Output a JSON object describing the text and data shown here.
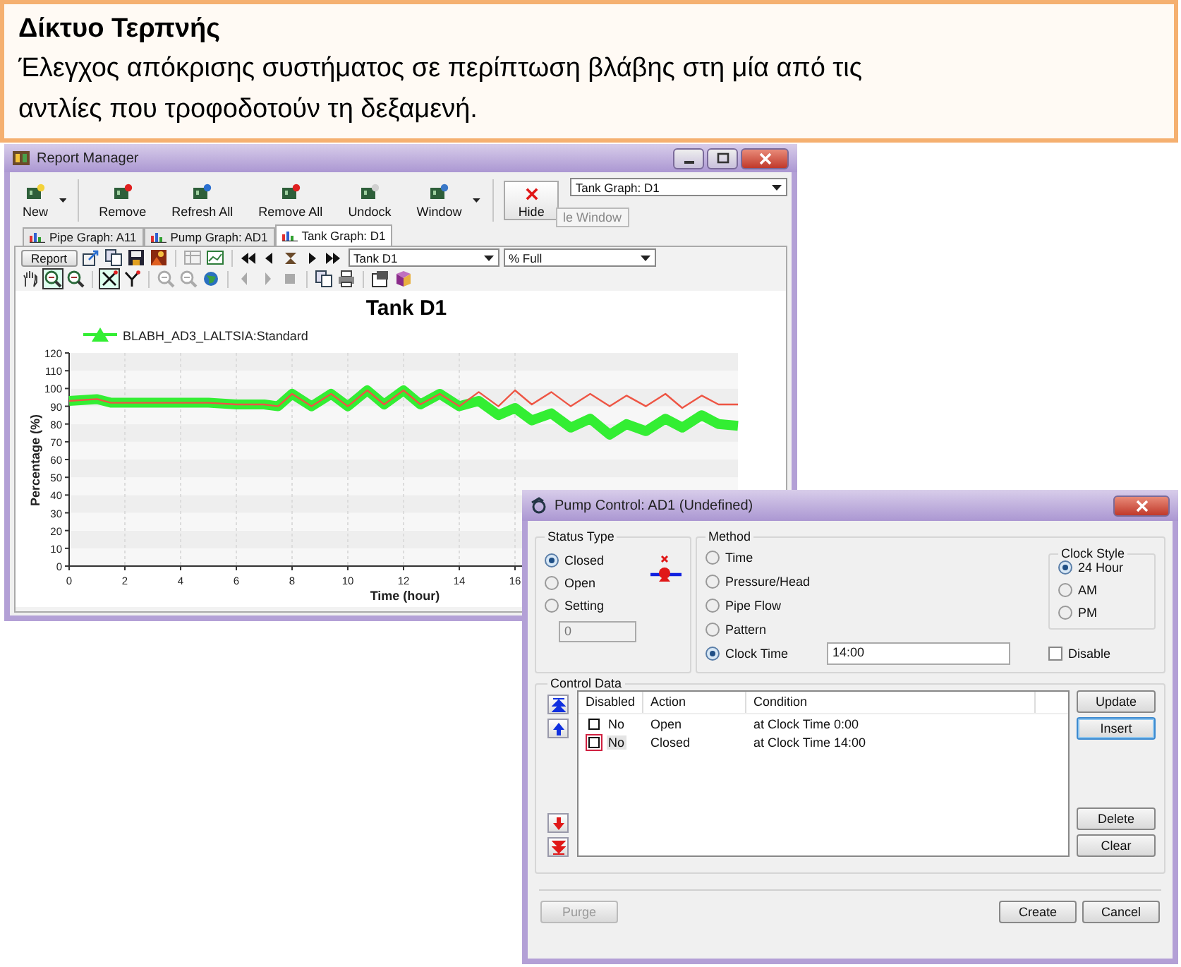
{
  "header": {
    "title": "Δίκτυο Τερπνής",
    "text": "Έλεγχος απόκρισης συστήματος σε περίπτωση βλάβης στη μία από τις αντλίες που τροφοδοτούν τη δεξαμενή."
  },
  "report_manager": {
    "title": "Report Manager",
    "toolbar": [
      {
        "label": "New",
        "kind": "new",
        "dropdown": true
      },
      {
        "label": "Remove",
        "kind": "remove",
        "dropdown": false
      },
      {
        "label": "Refresh All",
        "kind": "refresh",
        "dropdown": false
      },
      {
        "label": "Remove All",
        "kind": "remove",
        "dropdown": false
      },
      {
        "label": "Undock",
        "kind": "undock",
        "dropdown": false
      },
      {
        "label": "Window",
        "kind": "window",
        "dropdown": true
      }
    ],
    "hide_button": {
      "label": "Hide",
      "tooltip": "le Window"
    },
    "graph_select": "Tank Graph: D1",
    "tabs": [
      {
        "label": "Pipe Graph: A11",
        "selected": false
      },
      {
        "label": "Pump Graph: AD1",
        "selected": false
      },
      {
        "label": "Tank Graph: D1",
        "selected": true
      }
    ],
    "report_button": "Report",
    "object_select": "Tank D1",
    "variable_select": "% Full",
    "chart_data": {
      "type": "line",
      "title": "Tank D1",
      "xlabel": "Time (hour)",
      "ylabel": "Percentage (%)",
      "x": [
        0,
        1,
        1.5,
        3,
        4,
        5,
        6,
        7,
        7.5,
        8,
        8.7,
        9.4,
        10,
        10.7,
        11.3,
        12,
        12.6,
        13.3,
        14,
        14.7,
        15.4,
        16,
        16.6,
        17.3,
        18,
        18.7,
        19.4,
        20,
        20.7,
        21.4,
        22,
        22.7,
        23.3,
        24
      ],
      "series": [
        {
          "name": "BLABH_AD3_LALTSIA:Standard",
          "color": "#33ee33",
          "values": [
            93,
            94,
            92,
            92,
            92,
            92,
            91,
            91,
            90,
            97,
            90,
            97,
            90,
            99,
            91,
            99,
            91,
            97,
            90,
            93,
            85,
            89,
            82,
            86,
            78,
            83,
            74,
            80,
            76,
            83,
            78,
            85,
            80,
            79
          ]
        },
        {
          "color": "#ee5544",
          "values": [
            93,
            94,
            92,
            92,
            92,
            92,
            91,
            91,
            90,
            97,
            90,
            97,
            90,
            99,
            91,
            99,
            91,
            97,
            90,
            98,
            90,
            99,
            91,
            98,
            90,
            97,
            90,
            96,
            90,
            97,
            89,
            96,
            91,
            91
          ]
        }
      ],
      "xlim": [
        0,
        24
      ],
      "ylim": [
        0,
        120
      ],
      "grid": true,
      "xticks": [
        0,
        2,
        4,
        6,
        8,
        10,
        12,
        14,
        16
      ],
      "yticks": [
        0,
        10,
        20,
        30,
        40,
        50,
        60,
        70,
        80,
        90,
        100,
        110,
        120
      ]
    }
  },
  "pump_control": {
    "title": "Pump Control: AD1 (Undefined)",
    "status_type": {
      "label": "Status Type",
      "options": [
        {
          "label": "Closed",
          "selected": true
        },
        {
          "label": "Open",
          "selected": false
        },
        {
          "label": "Setting",
          "selected": false
        }
      ],
      "setting_value": "0"
    },
    "method": {
      "label": "Method",
      "options": [
        {
          "label": "Time",
          "selected": false
        },
        {
          "label": "Pressure/Head",
          "selected": false
        },
        {
          "label": "Pipe Flow",
          "selected": false
        },
        {
          "label": "Pattern",
          "selected": false
        },
        {
          "label": "Clock Time",
          "selected": true
        }
      ],
      "clock_time": "14:00"
    },
    "clock_style": {
      "label": "Clock Style",
      "options": [
        {
          "label": "24 Hour",
          "selected": true
        },
        {
          "label": "AM",
          "selected": false
        },
        {
          "label": "PM",
          "selected": false
        }
      ]
    },
    "disable": {
      "label": "Disable",
      "checked": false
    },
    "control_data": {
      "label": "Control Data",
      "columns": [
        "Disabled",
        "Action",
        "Condition"
      ],
      "rows": [
        {
          "disabled": "No",
          "checked": false,
          "focused": false,
          "action": "Open",
          "condition": "at Clock Time 0:00"
        },
        {
          "disabled": "No",
          "checked": false,
          "focused": true,
          "action": "Closed",
          "condition": "at Clock Time 14:00"
        }
      ],
      "side_buttons": [
        {
          "label": "Update",
          "default": false
        },
        {
          "label": "Insert",
          "default": true
        }
      ],
      "lower_buttons": [
        {
          "label": "Delete",
          "default": false
        },
        {
          "label": "Clear",
          "default": false
        }
      ]
    },
    "footer_buttons": [
      {
        "label": "Purge",
        "disabled": true
      },
      {
        "label": "Create",
        "disabled": false
      },
      {
        "label": "Cancel",
        "disabled": false
      }
    ]
  }
}
